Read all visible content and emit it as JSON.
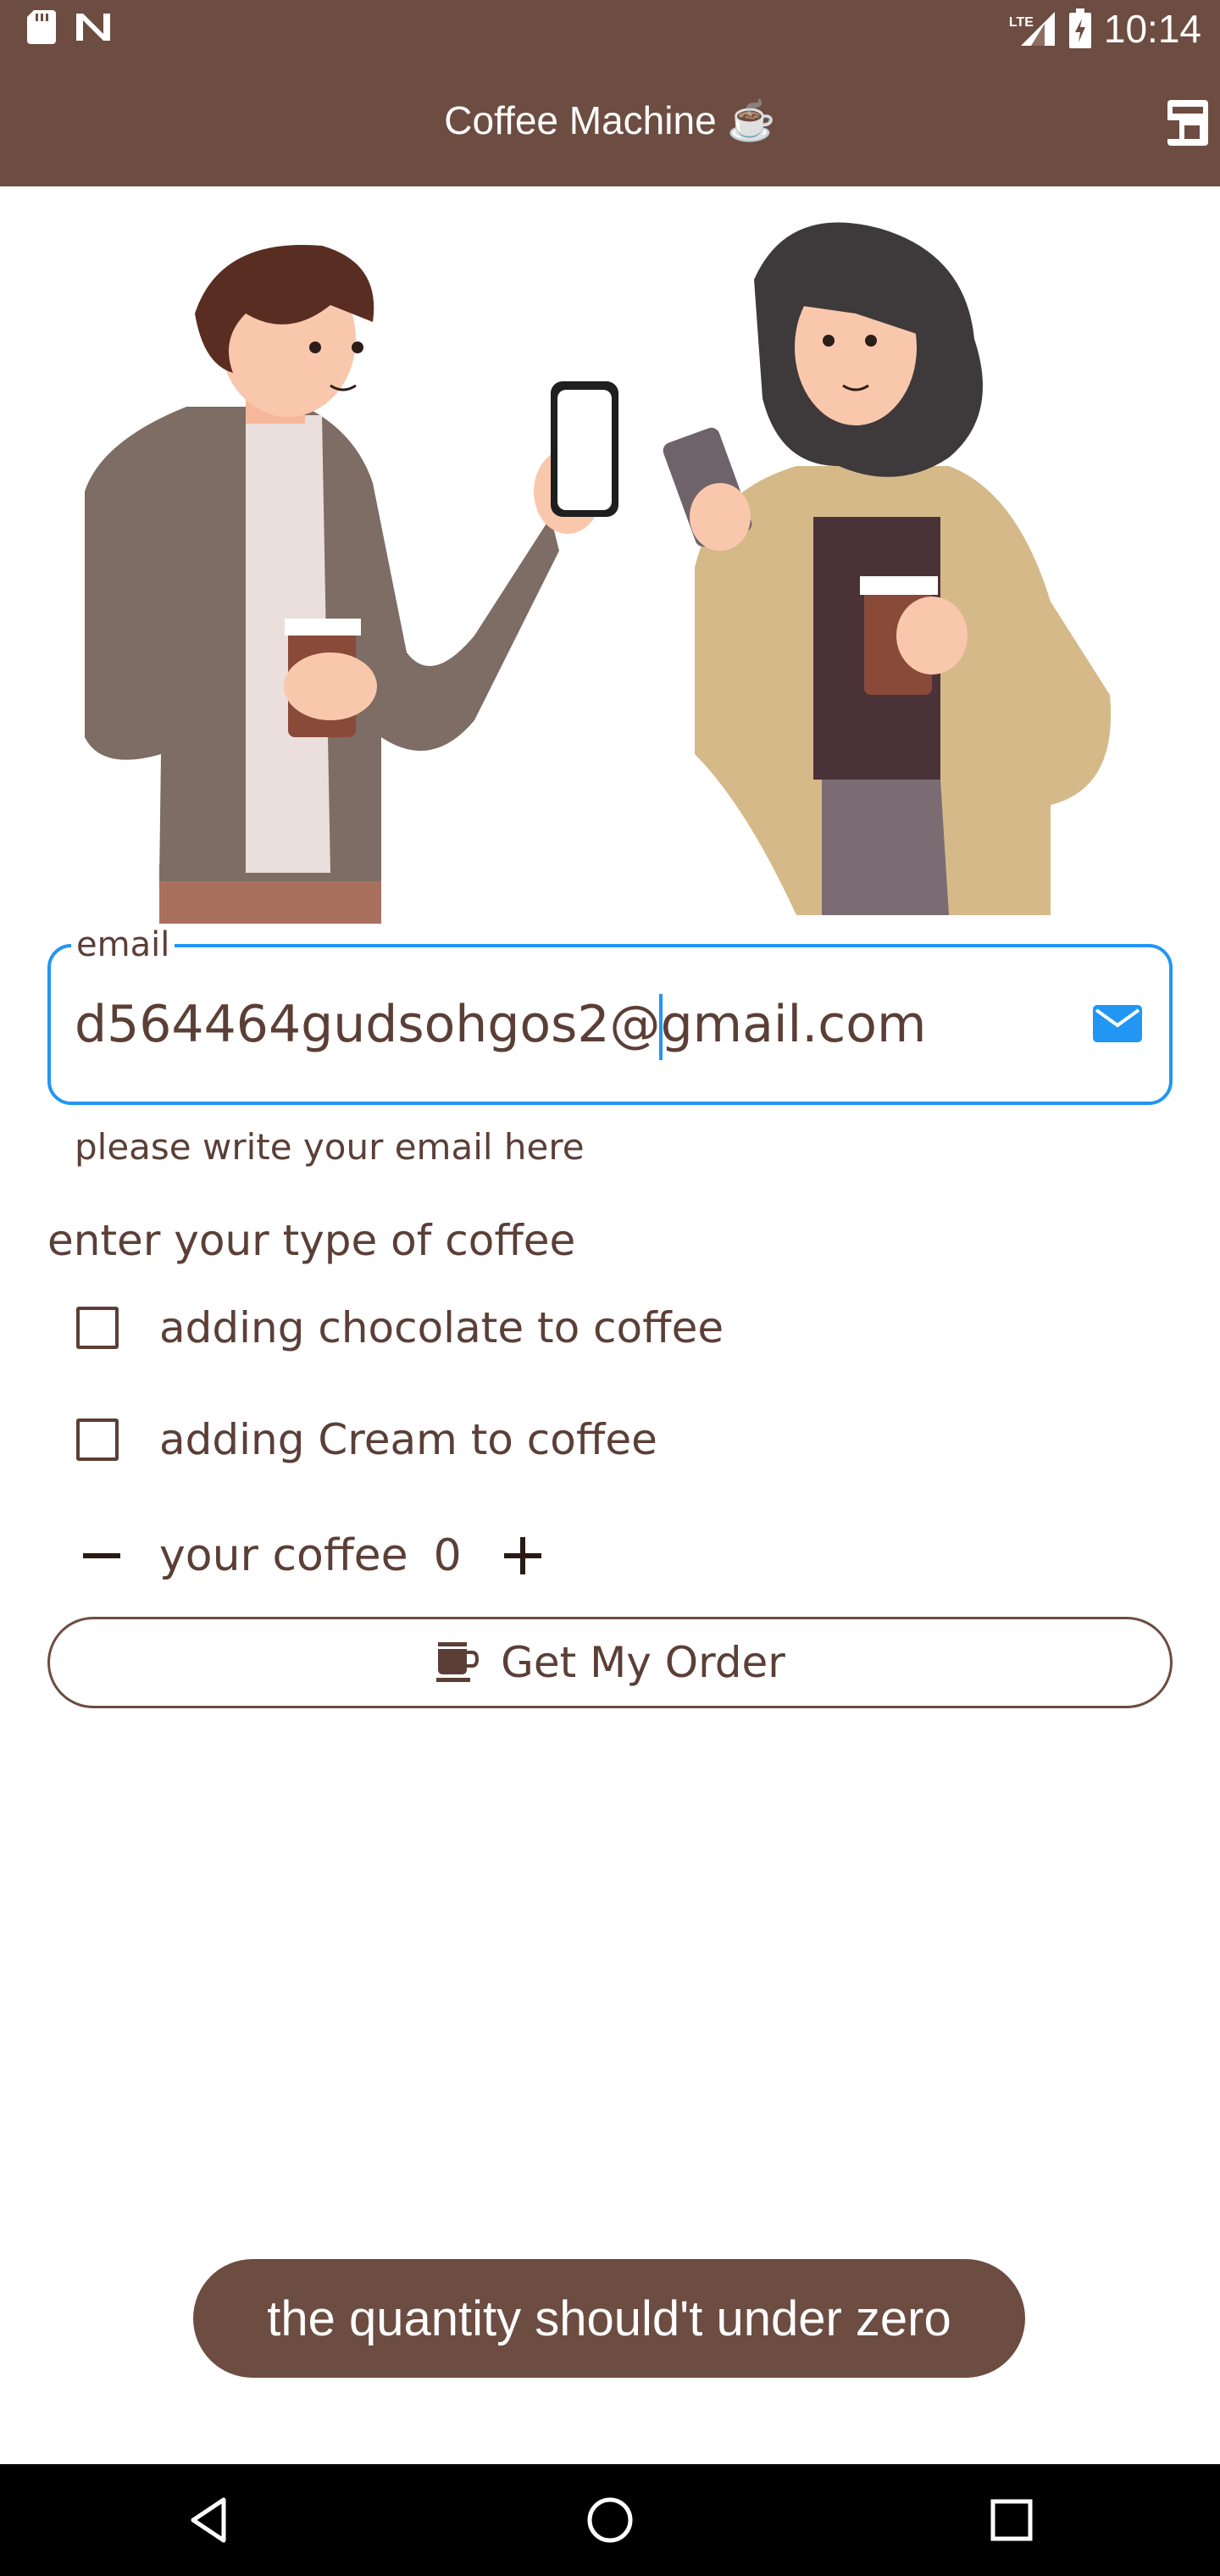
{
  "status_bar": {
    "time": "10:14",
    "network": "LTE",
    "icons": [
      "sd-card-icon",
      "n-icon",
      "signal-icon",
      "battery-charging-icon"
    ]
  },
  "app_bar": {
    "title": "Coffee Machine ☕",
    "action_icon": "coffee-machine-icon"
  },
  "email": {
    "label": "email",
    "value_before_caret": "d564464gudsohgos2@",
    "value_after_caret": "gmail.com",
    "helper": "please write your email here",
    "trailing_icon": "mail-icon"
  },
  "coffee_type": {
    "heading": "enter your type of coffee",
    "options": [
      {
        "label": "adding chocolate to coffee",
        "checked": false
      },
      {
        "label": "adding Cream to coffee",
        "checked": false
      }
    ]
  },
  "quantity": {
    "label": "your coffee",
    "value": "0"
  },
  "order_button": {
    "label": "Get My Order",
    "icon": "coffee-cup-icon"
  },
  "toast": {
    "message": "the quantity should't under zero"
  },
  "colors": {
    "primary": "#6d4c41",
    "accent": "#2196f3",
    "text": "#5b3f36"
  }
}
